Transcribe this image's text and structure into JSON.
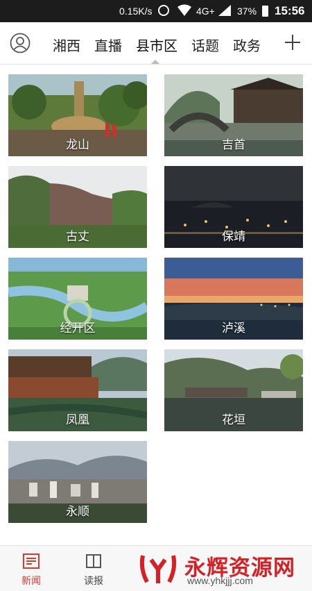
{
  "status": {
    "net_speed": "0.15K/s",
    "network": "4G+",
    "battery": "37%",
    "time": "15:56"
  },
  "nav": {
    "tabs": [
      "湘西",
      "直播",
      "县市区",
      "话题",
      "政务"
    ],
    "active_tab": "县市区"
  },
  "regions": [
    {
      "name": "龙山"
    },
    {
      "name": "吉首"
    },
    {
      "name": "古丈"
    },
    {
      "name": "保靖"
    },
    {
      "name": "经开区"
    },
    {
      "name": "泸溪"
    },
    {
      "name": "凤凰"
    },
    {
      "name": "花垣"
    },
    {
      "name": "永顺"
    }
  ],
  "bottom_nav": {
    "items": [
      "新闻",
      "读报"
    ],
    "active": "新闻"
  },
  "watermark": {
    "text": "永辉资源网",
    "url": "www.yhkjjj.com"
  }
}
